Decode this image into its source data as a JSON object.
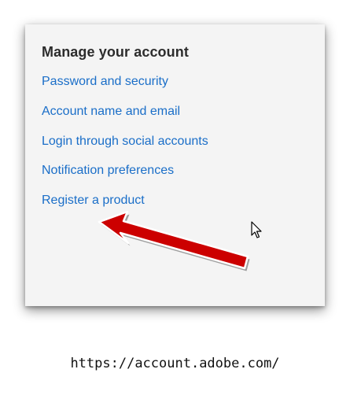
{
  "panel": {
    "title": "Manage your account",
    "links": [
      {
        "label": "Password and security"
      },
      {
        "label": "Account name and email"
      },
      {
        "label": "Login through social accounts"
      },
      {
        "label": "Notification preferences"
      },
      {
        "label": "Register a product"
      }
    ]
  },
  "annotation": {
    "arrow_color": "#cc0000",
    "target": "Register a product"
  },
  "cursor": {
    "icon": "mouse-pointer-icon"
  },
  "caption": {
    "url": "https://account.adobe.com/"
  },
  "colors": {
    "link": "#1a6ec8",
    "panel_bg": "#f4f4f4",
    "title": "#2c2c2c"
  }
}
